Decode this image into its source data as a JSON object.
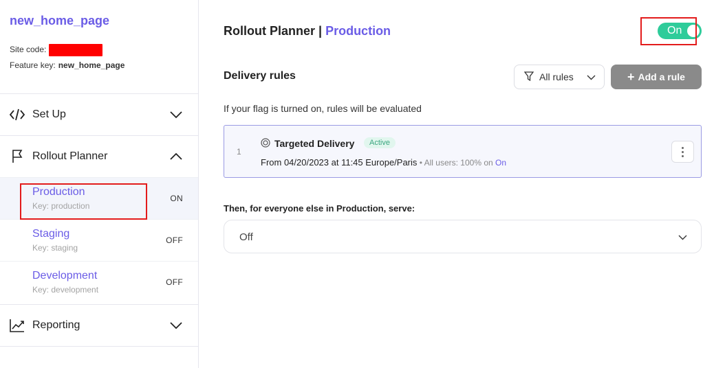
{
  "sidebar": {
    "flag_name": "new_home_page",
    "site_code_label": "Site code:",
    "feature_key_label": "Feature key:",
    "feature_key_value": "new_home_page",
    "sections": {
      "setup": {
        "label": "Set Up",
        "icon": "code-icon"
      },
      "rollout": {
        "label": "Rollout Planner",
        "icon": "flag-icon"
      },
      "reporting": {
        "label": "Reporting",
        "icon": "chart-icon"
      }
    },
    "environments": [
      {
        "name": "Production",
        "key": "Key: production",
        "status": "ON"
      },
      {
        "name": "Staging",
        "key": "Key: staging",
        "status": "OFF"
      },
      {
        "name": "Development",
        "key": "Key: development",
        "status": "OFF"
      }
    ]
  },
  "main": {
    "title": "Rollout Planner |",
    "env": "Production",
    "toggle_label": "On",
    "delivery_title": "Delivery rules",
    "filter_label": "All rules",
    "add_rule_label": "Add a rule",
    "hint": "If your flag is turned on, rules will be evaluated",
    "rule": {
      "number": "1",
      "name": "Targeted Delivery",
      "badge": "Active",
      "desc_main": "From 04/20/2023 at 11:45 Europe/Paris",
      "desc_muted": " • All users: 100% on ",
      "desc_on": "On"
    },
    "serve_title": "Then, for everyone else in Production, serve:",
    "serve_value": "Off"
  },
  "colors": {
    "accent": "#6a5ce6",
    "toggle_on": "#2ecc9a",
    "highlight": "#e31b1b",
    "badge_bg": "#e1f6ee",
    "badge_text": "#3aa57f"
  }
}
